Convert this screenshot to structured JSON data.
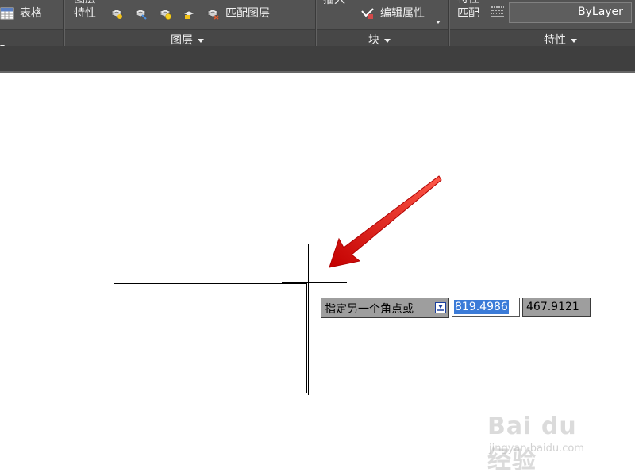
{
  "ribbon": {
    "table_label": "表格",
    "layer_props_line1": "图层",
    "layer_props_line2": "特性",
    "match_layer_label": "匹配图层",
    "insert_label": "插入",
    "edit_attr_label": "编辑属性",
    "match_props_line1": "特性",
    "match_props_line2": "匹配",
    "bylayer_value": "ByLayer",
    "panels": {
      "layers": "图层",
      "block": "块",
      "properties": "特性"
    }
  },
  "icons": [
    "table-icon",
    "layer-icon",
    "edit-attribute-icon",
    "linetype-icon",
    "dropdown-icon"
  ],
  "canvas": {
    "prompt_text": "指定另一个角点或",
    "coord_x": "819.4986",
    "coord_y": "467.9121"
  },
  "watermark": {
    "brand": "Bai du 经验",
    "url": "jingyan.baidu.com"
  },
  "colors": {
    "ribbon_bg": "#535353",
    "selection": "#3b7bd8",
    "arrow": "#e01010"
  }
}
